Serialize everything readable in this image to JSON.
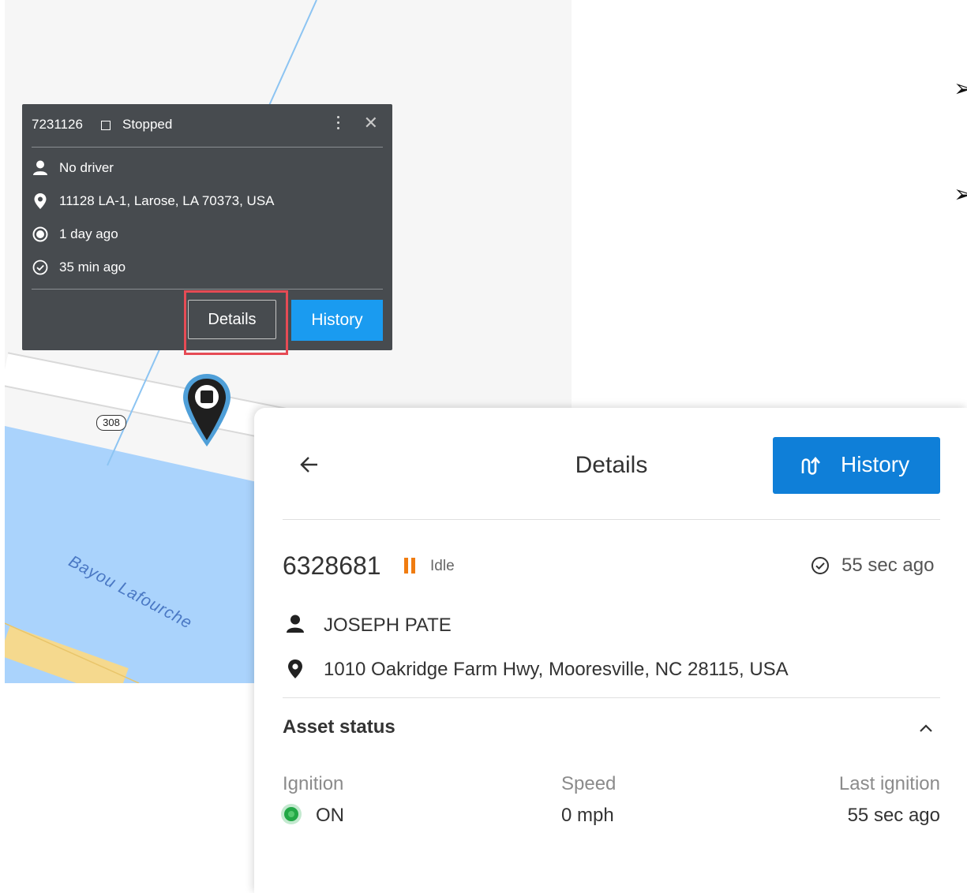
{
  "map": {
    "water_label": "Bayou Lafourche",
    "route_shield": "308"
  },
  "popup": {
    "asset_id": "7231126",
    "status": "Stopped",
    "driver": "No driver",
    "address": "11128 LA-1, Larose, LA 70373, USA",
    "last_gps": "1 day ago",
    "last_check": "35 min ago",
    "details_label": "Details",
    "history_label": "History",
    "colors": {
      "background": "#474b4f",
      "history_button": "#1a9bf0",
      "highlight": "#e64b55"
    }
  },
  "details_panel": {
    "title": "Details",
    "history_label": "History",
    "asset_id": "6328681",
    "status": "Idle",
    "last_update": "55 sec ago",
    "driver": "JOSEPH PATE",
    "address": "1010 Oakridge Farm Hwy, Mooresville, NC 28115, USA",
    "asset_status": {
      "title": "Asset status",
      "ignition_label": "Ignition",
      "ignition_value": "ON",
      "speed_label": "Speed",
      "speed_value": "0 mph",
      "last_ignition_label": "Last ignition",
      "last_ignition_value": "55 sec ago"
    },
    "colors": {
      "history_button": "#0f7fd8",
      "idle": "#f07c10",
      "ignition_on": "#22a846"
    }
  },
  "bullets": [
    "➢",
    "➢"
  ]
}
